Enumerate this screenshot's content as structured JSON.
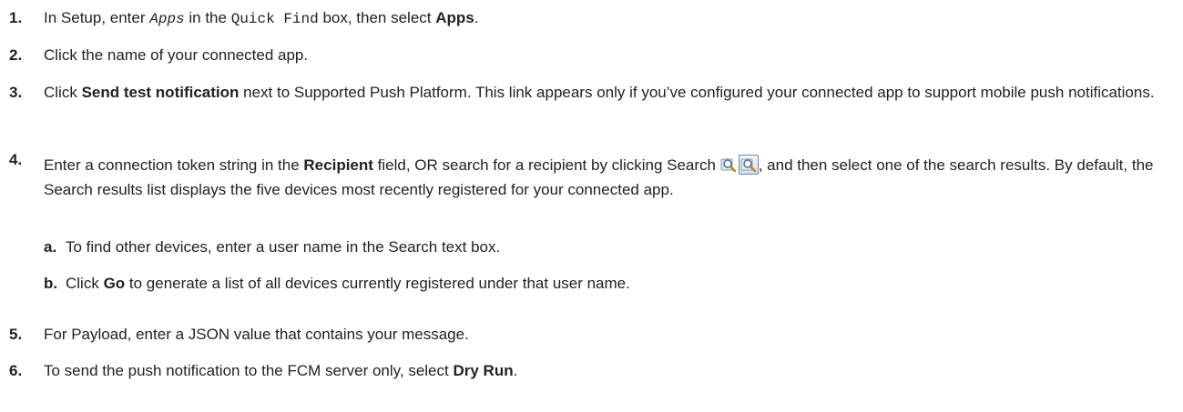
{
  "steps": [
    {
      "num": "1.",
      "parts": {
        "p1": "In Setup, enter ",
        "code1": "Apps",
        "p2": " in the ",
        "code2": "Quick Find",
        "p3": " box, then select ",
        "bold1": "Apps",
        "p4": "."
      }
    },
    {
      "num": "2.",
      "parts": {
        "p1": "Click the name of your connected app."
      }
    },
    {
      "num": "3.",
      "parts": {
        "p1": "Click ",
        "bold1": "Send test notification",
        "p2": " next to Supported Push Platform. This link appears only if you’ve configured your connected app to support mobile push notifications."
      }
    },
    {
      "num": "4.",
      "parts": {
        "p1": "Enter a connection token string in the ",
        "bold1": "Recipient",
        "p2": " field, OR search for a recipient by clicking Search ",
        "p3": ", and then select one of the search results. By default, the Search results list displays the five devices most recently registered for your connected app."
      },
      "icons": [
        "lookup-icon",
        "lookup-icon-hover"
      ],
      "substeps": [
        {
          "num": "a.",
          "p1": "To find other devices, enter a user name in the Search text box."
        },
        {
          "num": "b.",
          "p1": "Click ",
          "bold1": "Go",
          "p2": " to generate a list of all devices currently registered under that user name."
        }
      ]
    },
    {
      "num": "5.",
      "parts": {
        "p1": "For Payload, enter a JSON value that contains your message."
      }
    },
    {
      "num": "6.",
      "parts": {
        "p1": "To send the push notification to the FCM server only, select ",
        "bold1": "Dry Run",
        "p2": "."
      }
    }
  ],
  "colors": {
    "text": "#222222",
    "icon_border": "#6f86a8"
  }
}
